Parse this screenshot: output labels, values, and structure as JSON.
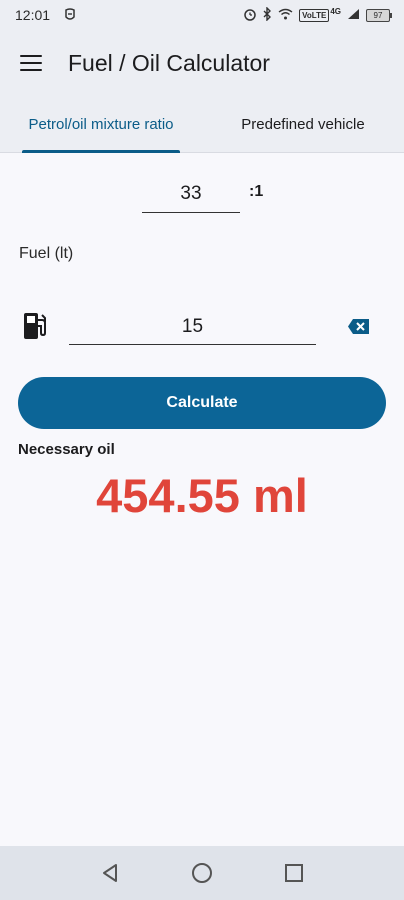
{
  "status_bar": {
    "time": "12:01",
    "network": "4G",
    "volte": "VoLTE",
    "battery": "97"
  },
  "app_bar": {
    "title": "Fuel / Oil Calculator",
    "menu_icon": "hamburger-menu-icon"
  },
  "tabs": [
    {
      "label": "Petrol/oil mixture ratio",
      "active": true
    },
    {
      "label": "Predefined vehicle",
      "active": false
    }
  ],
  "ratio": {
    "value": "33",
    "suffix": ":1"
  },
  "fuel": {
    "label": "Fuel (lt)",
    "value": "15",
    "icon": "fuel-pump-icon",
    "clear_icon": "backspace-icon"
  },
  "calculate_button": {
    "label": "Calculate"
  },
  "result": {
    "label": "Necessary oil",
    "value": "454.55 ml"
  },
  "nav_bar": {
    "back_icon": "back-triangle-icon",
    "home_icon": "home-circle-icon",
    "recents_icon": "recents-square-icon"
  },
  "colors": {
    "accent": "#0b5c88",
    "button": "#0c6597",
    "result": "#e0453a",
    "background": "#f8f8fc"
  }
}
